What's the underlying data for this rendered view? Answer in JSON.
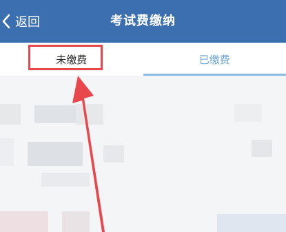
{
  "header": {
    "back_label": "返回",
    "title": "考试费缴纳",
    "background_color": "#3b6fb0"
  },
  "tabs": [
    {
      "label": "未缴费",
      "active": false
    },
    {
      "label": "已缴费",
      "active": true
    }
  ],
  "annotation": {
    "highlight_color": "#e8474d",
    "icon": "red-arrow-icon"
  },
  "icons": {
    "back": "chevron-left-icon"
  }
}
